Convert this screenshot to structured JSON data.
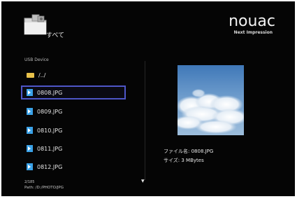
{
  "header": {
    "title": "すべて",
    "logo_main": "nouac",
    "logo_sub": "Next Impression"
  },
  "section_label": "USB Device",
  "list": {
    "parent_dir": "/../",
    "items": [
      "0808.JPG",
      "0809.JPG",
      "0810.JPG",
      "0811.JPG",
      "0812.JPG"
    ],
    "selected_index": 0
  },
  "footer": {
    "page_count": "2/185",
    "path": "Path: /D:/PHOTO/JPG"
  },
  "details": {
    "filename": "ファイル名: 0808.JPG",
    "size": "サイズ: 3 MBytes"
  },
  "colors": {
    "background": "#050505",
    "selection_border": "#4e56c8",
    "file_icon": "#3aa2e8",
    "folder_icon": "#e8c14a"
  }
}
